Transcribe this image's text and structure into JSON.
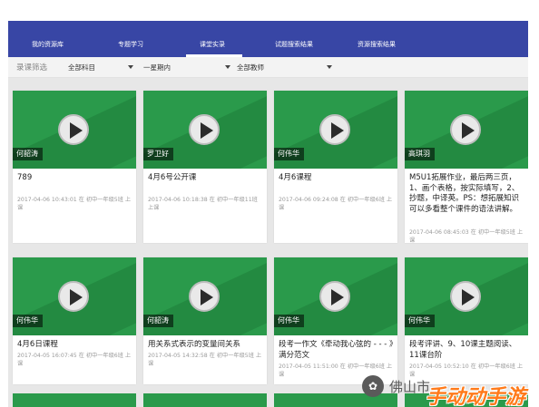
{
  "nav": {
    "items": [
      {
        "label": "我的资源库"
      },
      {
        "label": "专题学习"
      },
      {
        "label": "课堂实录"
      },
      {
        "label": "试题搜索结果"
      },
      {
        "label": "资源搜索结果"
      }
    ],
    "active_index": 2
  },
  "filters": {
    "label": "录课筛选",
    "subject": "全部科目",
    "period": "一星期内",
    "teacher": "全部教师"
  },
  "cards": [
    {
      "teacher": "何韶涛",
      "title": "789",
      "meta": "2017-04-06 10:43:01 在 初中一年级5班 上课"
    },
    {
      "teacher": "罗卫好",
      "title": "4月6号公开课",
      "meta": "2017-04-06 10:18:38 在 初中一年级11班 上课"
    },
    {
      "teacher": "何伟华",
      "title": "4月6课程",
      "meta": "2017-04-06 09:24:08 在 初中一年级6班 上课"
    },
    {
      "teacher": "高琪羽",
      "title": "M5U1拓展作业，最后两三页，1、画个表格，按实际填写，2、抄题，中译英。PS：想拓展知识可以多看整个课件的语法讲解。",
      "meta": "2017-04-06 08:45:03 在 初中一年级5班 上课"
    },
    {
      "teacher": "何伟华",
      "title": "4月6日课程",
      "meta": "2017-04-05 16:07:45 在 初中一年级6班 上课"
    },
    {
      "teacher": "何韶涛",
      "title": "用关系式表示的变量间关系",
      "meta": "2017-04-05 14:32:58 在 初中一年级5班 上课"
    },
    {
      "teacher": "何伟华",
      "title": "段考一作文《牵动我心弦的 - - - 》满分范文",
      "meta": "2017-04-05 11:51:00 在 初中一年级6班 上课"
    },
    {
      "teacher": "何伟华",
      "title": "段考评讲、9、10课主题阅读、11课台阶",
      "meta": "2017-04-05 10:52:10 在 初中一年级6班 上课"
    }
  ],
  "watermark": {
    "logo": "✿",
    "text": "佛山市",
    "brand": "手动动手游"
  }
}
